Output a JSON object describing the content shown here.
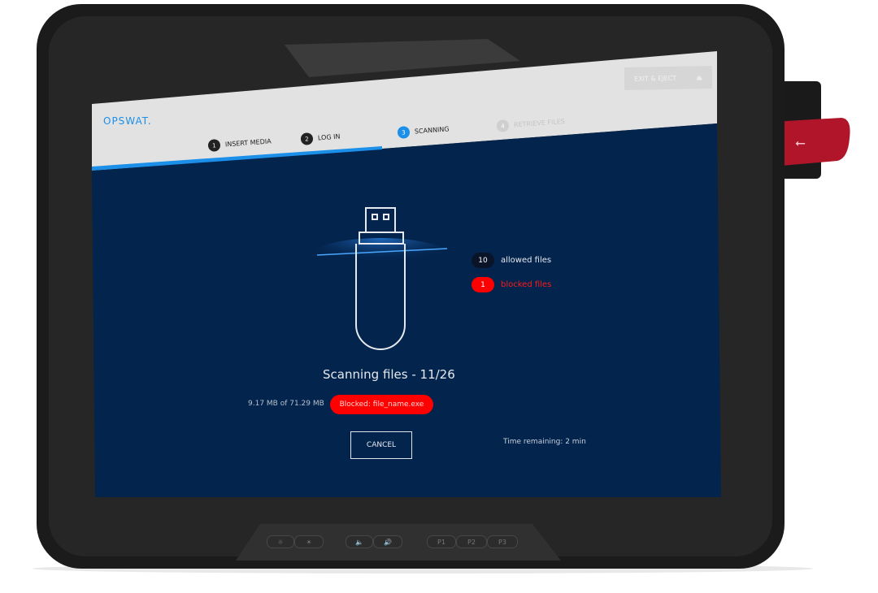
{
  "header": {
    "logo": "OPSWAT.",
    "exit_button": "EXIT & EJECT",
    "steps": [
      {
        "num": "1",
        "label": "INSERT MEDIA",
        "state": "done"
      },
      {
        "num": "2",
        "label": "LOG IN",
        "state": "done"
      },
      {
        "num": "3",
        "label": "SCANNING",
        "state": "active"
      },
      {
        "num": "4",
        "label": "RETRIEVE FILES",
        "state": "pending"
      }
    ]
  },
  "scan": {
    "title": "Scanning files - 11/26",
    "progress_text": "9.17 MB of 71.29 MB",
    "blocked_badge": "Blocked: file_name.exe",
    "allowed_count": "10",
    "allowed_label": "allowed files",
    "blocked_count": "1",
    "blocked_label": "blocked files",
    "cancel": "CANCEL",
    "time_remaining": "Time remaining: 2 min"
  },
  "hardware_buttons": {
    "p1": "P1",
    "p2": "P2",
    "p3": "P3",
    "icons": [
      "brightness-down-icon",
      "brightness-up-icon",
      "volume-down-icon",
      "volume-up-icon"
    ]
  },
  "colors": {
    "accent": "#1c8fe8",
    "screen_bg": "#03244d",
    "blocked": "#ff0000",
    "header_bg": "#e2e2e2"
  }
}
